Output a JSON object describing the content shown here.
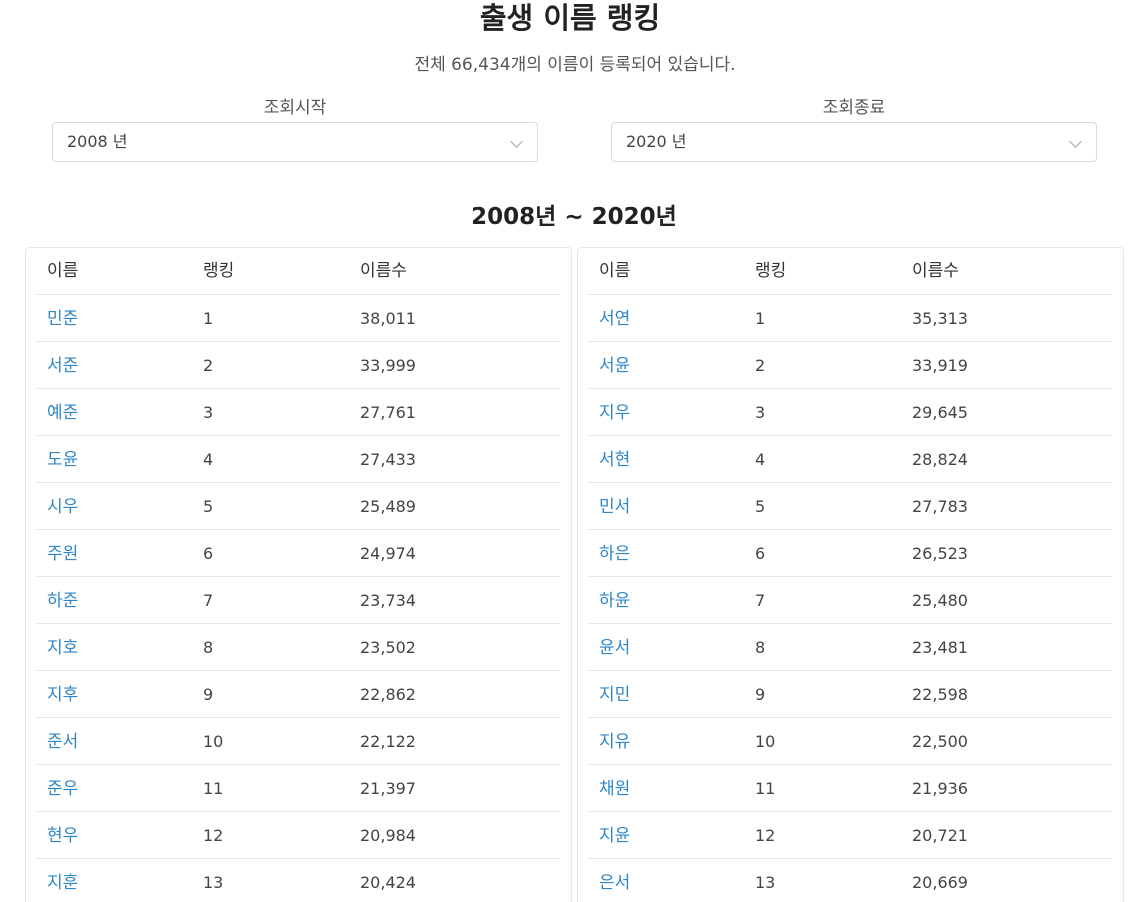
{
  "title": "출생 이름 랭킹",
  "subtitle": "전체 66,434개의 이름이 등록되어 있습니다.",
  "filters": {
    "start": {
      "label": "조회시작",
      "value": "2008 년"
    },
    "end": {
      "label": "조회종료",
      "value": "2020 년"
    }
  },
  "range_title": "2008년 ~ 2020년",
  "columns": {
    "name": "이름",
    "rank": "랭킹",
    "count": "이름수"
  },
  "tables": {
    "left": [
      {
        "name": "민준",
        "rank": "1",
        "count": "38,011"
      },
      {
        "name": "서준",
        "rank": "2",
        "count": "33,999"
      },
      {
        "name": "예준",
        "rank": "3",
        "count": "27,761"
      },
      {
        "name": "도윤",
        "rank": "4",
        "count": "27,433"
      },
      {
        "name": "시우",
        "rank": "5",
        "count": "25,489"
      },
      {
        "name": "주원",
        "rank": "6",
        "count": "24,974"
      },
      {
        "name": "하준",
        "rank": "7",
        "count": "23,734"
      },
      {
        "name": "지호",
        "rank": "8",
        "count": "23,502"
      },
      {
        "name": "지후",
        "rank": "9",
        "count": "22,862"
      },
      {
        "name": "준서",
        "rank": "10",
        "count": "22,122"
      },
      {
        "name": "준우",
        "rank": "11",
        "count": "21,397"
      },
      {
        "name": "현우",
        "rank": "12",
        "count": "20,984"
      },
      {
        "name": "지훈",
        "rank": "13",
        "count": "20,424"
      }
    ],
    "right": [
      {
        "name": "서연",
        "rank": "1",
        "count": "35,313"
      },
      {
        "name": "서윤",
        "rank": "2",
        "count": "33,919"
      },
      {
        "name": "지우",
        "rank": "3",
        "count": "29,645"
      },
      {
        "name": "서현",
        "rank": "4",
        "count": "28,824"
      },
      {
        "name": "민서",
        "rank": "5",
        "count": "27,783"
      },
      {
        "name": "하은",
        "rank": "6",
        "count": "26,523"
      },
      {
        "name": "하윤",
        "rank": "7",
        "count": "25,480"
      },
      {
        "name": "윤서",
        "rank": "8",
        "count": "23,481"
      },
      {
        "name": "지민",
        "rank": "9",
        "count": "22,598"
      },
      {
        "name": "지유",
        "rank": "10",
        "count": "22,500"
      },
      {
        "name": "채원",
        "rank": "11",
        "count": "21,936"
      },
      {
        "name": "지윤",
        "rank": "12",
        "count": "20,721"
      },
      {
        "name": "은서",
        "rank": "13",
        "count": "20,669"
      }
    ]
  },
  "colors": {
    "link": "#2f86c9",
    "border": "#e6e6e6"
  }
}
